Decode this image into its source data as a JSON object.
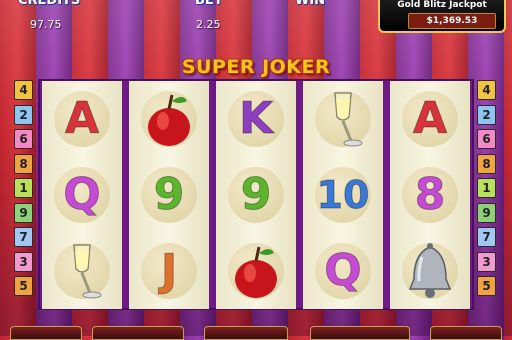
{
  "header": {
    "credits_label": "CREDITS",
    "credits_value": "97.75",
    "bet_label": "BET",
    "bet_value": "2.25",
    "win_label": "WIN",
    "jackpot_title": "Gold Blitz Jackpot",
    "jackpot_value": "$1,369.53"
  },
  "game_title": "SUPER JOKER",
  "colors": {
    "frame": "#6f1a86",
    "title_gold": "#f5c518",
    "reel_background": "#f4f1dc"
  },
  "reels": [
    [
      {
        "icon": "letter-a",
        "label": "A",
        "color": "#d6333b"
      },
      {
        "icon": "letter-q",
        "label": "Q",
        "color": "#c64bd4"
      },
      {
        "icon": "champagne-glass-icon",
        "label": "",
        "color": ""
      }
    ],
    [
      {
        "icon": "apple-icon",
        "label": "",
        "color": ""
      },
      {
        "icon": "number-9",
        "label": "9",
        "color": "#5bb52d"
      },
      {
        "icon": "letter-j",
        "label": "J",
        "color": "#e0712a"
      }
    ],
    [
      {
        "icon": "letter-k",
        "label": "K",
        "color": "#8e3fc0"
      },
      {
        "icon": "number-9",
        "label": "9",
        "color": "#5bb52d"
      },
      {
        "icon": "apple-icon",
        "label": "",
        "color": ""
      }
    ],
    [
      {
        "icon": "champagne-glass-icon",
        "label": "",
        "color": ""
      },
      {
        "icon": "number-10",
        "label": "10",
        "color": "#3a78d8"
      },
      {
        "icon": "letter-q",
        "label": "Q",
        "color": "#c64bd4"
      }
    ],
    [
      {
        "icon": "letter-a",
        "label": "A",
        "color": "#d6333b"
      },
      {
        "icon": "number-8",
        "label": "8",
        "color": "#c64bd4"
      },
      {
        "icon": "bell-icon",
        "label": "",
        "color": ""
      }
    ]
  ],
  "paylines_left": [
    {
      "label": "4",
      "color": "#f2c341"
    },
    {
      "label": "2",
      "color": "#8ec4f2"
    },
    {
      "label": "6",
      "color": "#f28ac4"
    },
    {
      "label": "8",
      "color": "#f2a341"
    },
    {
      "label": "1",
      "color": "#b8e05a"
    },
    {
      "label": "9",
      "color": "#8ed07a"
    },
    {
      "label": "7",
      "color": "#a0c8f2"
    },
    {
      "label": "3",
      "color": "#f29ad0"
    },
    {
      "label": "5",
      "color": "#f2a341"
    }
  ],
  "paylines_right": [
    {
      "label": "4",
      "color": "#f2c341"
    },
    {
      "label": "2",
      "color": "#8ec4f2"
    },
    {
      "label": "6",
      "color": "#f28ac4"
    },
    {
      "label": "8",
      "color": "#f2a341"
    },
    {
      "label": "1",
      "color": "#b8e05a"
    },
    {
      "label": "9",
      "color": "#8ed07a"
    },
    {
      "label": "7",
      "color": "#a0c8f2"
    },
    {
      "label": "3",
      "color": "#f29ad0"
    },
    {
      "label": "5",
      "color": "#f2a341"
    }
  ]
}
